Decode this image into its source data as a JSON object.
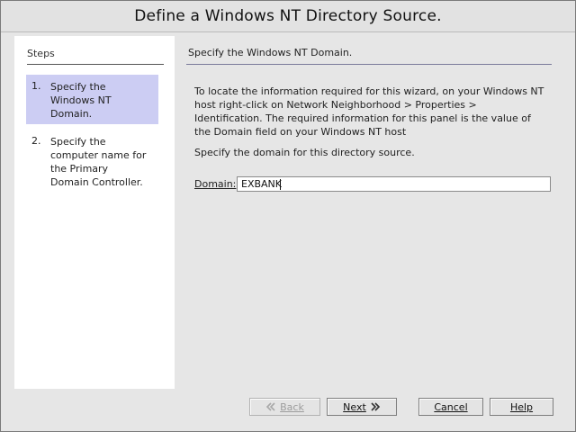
{
  "window": {
    "title": "Define a Windows NT Directory Source."
  },
  "steps": {
    "title": "Steps",
    "items": [
      {
        "num": "1.",
        "label": "Specify the Windows NT Domain.",
        "active": true
      },
      {
        "num": "2.",
        "label": "Specify the computer name for the Primary Domain Controller.",
        "active": false
      }
    ]
  },
  "panel": {
    "title": "Specify the Windows NT Domain.",
    "info": "To locate the information required for this wizard, on your Windows NT host right-click on Network Neighborhood > Properties > Identification. The required information for this panel is the value of the Domain field on your Windows NT host",
    "prompt": "Specify the domain for this directory source.",
    "domain_label": "Domain:",
    "domain_value": "EXBANK"
  },
  "buttons": {
    "back": "Back",
    "next": "Next",
    "cancel": "Cancel",
    "help": "Help"
  },
  "colors": {
    "active_step": "#cccdf3",
    "panel_bg": "#ffffff",
    "window_bg": "#e6e6e6"
  },
  "icons": {
    "back": "double-left-chevron-icon",
    "next": "double-right-chevron-icon"
  }
}
